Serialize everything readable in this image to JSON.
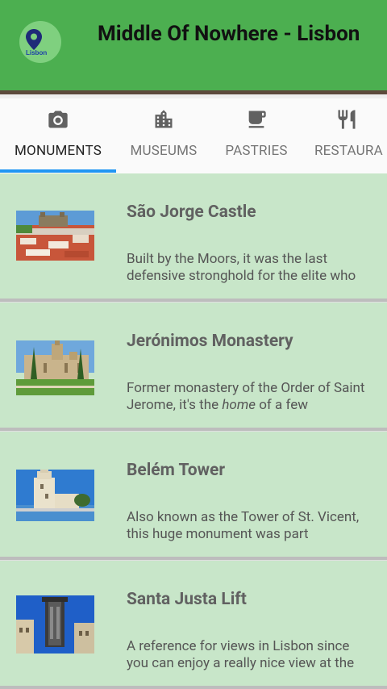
{
  "app": {
    "title": "Middle Of Nowhere - Lisbon",
    "logo_text": "Lisbon"
  },
  "tabs": [
    {
      "label": "MONUMENTS",
      "icon": "camera-icon",
      "active": true
    },
    {
      "label": "MUSEUMS",
      "icon": "building-icon",
      "active": false
    },
    {
      "label": "PASTRIES",
      "icon": "coffee-icon",
      "active": false
    },
    {
      "label": "RESTAURA",
      "icon": "fork-knife-icon",
      "active": false
    }
  ],
  "items": [
    {
      "title": "São Jorge Castle",
      "desc_parts": [
        "Built by the Moors, it was the last defensive stronghold for the elite who"
      ]
    },
    {
      "title": "Jerónimos Monastery",
      "desc_before": "Former monastery of the Order of Saint Jerome, it's the ",
      "desc_em": "home",
      "desc_after": " of a few"
    },
    {
      "title": "Belém Tower",
      "desc": "Also known as the Tower of St. Vicent, this huge monument was part"
    },
    {
      "title": "Santa Justa Lift",
      "desc": "A reference for views in Lisbon since you can enjoy a really nice view at the"
    }
  ],
  "colors": {
    "appbar": "#4caf50",
    "card": "#c8e6c9",
    "tab_indicator": "#2196f3"
  }
}
